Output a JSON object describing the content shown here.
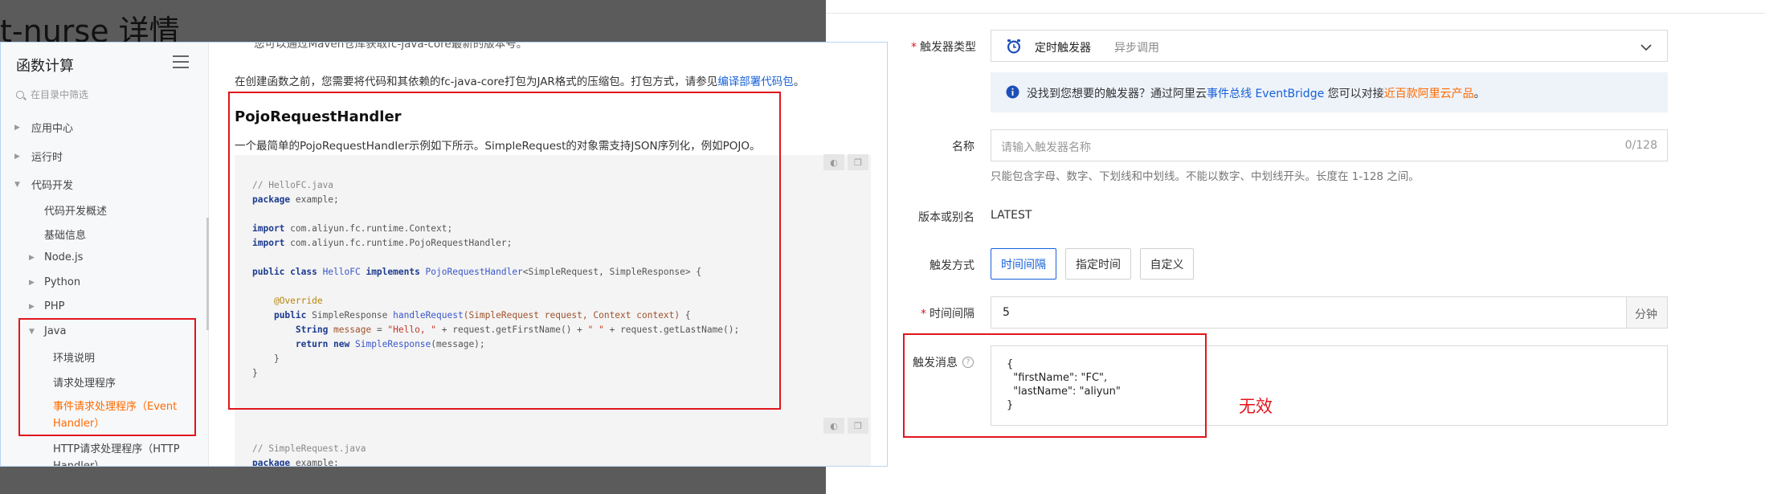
{
  "background": {
    "page_title": "t-nurse 详情"
  },
  "docs": {
    "sidebar": {
      "title": "函数计算",
      "filter_placeholder": "在目录中筛选",
      "items": [
        {
          "label": "应用中心"
        },
        {
          "label": "运行时"
        },
        {
          "label": "代码开发"
        },
        {
          "label": "代码开发概述"
        },
        {
          "label": "基础信息"
        },
        {
          "label": "Node.js"
        },
        {
          "label": "Python"
        },
        {
          "label": "PHP"
        },
        {
          "label": "Java"
        },
        {
          "label": "环境说明"
        },
        {
          "label": "请求处理程序"
        },
        {
          "label": "事件请求处理程序（Event"
        },
        {
          "label": "Handler）"
        },
        {
          "label": "HTTP请求处理程序（HTTP"
        },
        {
          "label": "Handler）"
        }
      ]
    },
    "content": {
      "top_partial": "您可以通过Maven仓库获取fc-java-core最新的版本号。",
      "intro_prefix": "在创建函数之前，您需要将代码和其依赖的fc-java-core打包为JAR格式的压缩包。打包方式，请参见",
      "intro_link": "编译部署代码包",
      "intro_suffix": "。",
      "heading": "PojoRequestHandler",
      "desc": "一个最简单的PojoRequestHandler示例如下所示。SimpleRequest的对象需支持JSON序列化，例如POJO。",
      "code1": {
        "comment": "// HelloFC.java",
        "package_kw": "package",
        "package_name": " example;",
        "import_kw": "import",
        "import1": " com.aliyun.fc.runtime.Context;",
        "import2": " com.aliyun.fc.runtime.PojoRequestHandler;",
        "class_decl_kw": "public class",
        "class_name": " HelloFC ",
        "implements_kw": "implements",
        "iface": " PojoRequestHandler",
        "generics": "<SimpleRequest, SimpleResponse> {",
        "annotation": "@Override",
        "method_kw": "public",
        "method_type": " SimpleResponse ",
        "method_name": "handleRequest",
        "method_params": "(SimpleRequest request, Context context)",
        "method_open": " {",
        "string_type": "String",
        "var_name": " message",
        "assign": " = ",
        "str1": "\"Hello, \"",
        "concat1": " + request.getFirstName() + ",
        "str2": "\" \"",
        "concat2": " + request.getLastName();",
        "return_kw": "return new",
        "return_type": " SimpleResponse",
        "return_rest": "(message);",
        "close1": "}",
        "close2": "}"
      },
      "code2": {
        "comment": "// SimpleRequest.java",
        "package_kw": "package",
        "package_name": " example;"
      }
    }
  },
  "form": {
    "trigger_type_label": "触发器类型",
    "trigger_type_value": "定时触发器",
    "trigger_type_sub": "异步调用",
    "info_prefix": "没找到您想要的触发器？通过阿里云",
    "info_link1": "事件总线 EventBridge",
    "info_mid": " 您可以对接",
    "info_link2": "近百款阿里云产品",
    "info_suffix": "。",
    "name_label": "名称",
    "name_placeholder": "请输入触发器名称",
    "name_counter": "0/128",
    "name_hint": "只能包含字母、数字、下划线和中划线。不能以数字、中划线开头。长度在 1-128 之间。",
    "version_label": "版本或别名",
    "version_value": "LATEST",
    "mode_label": "触发方式",
    "mode_options": [
      "时间间隔",
      "指定时间",
      "自定义"
    ],
    "interval_label": "时间间隔",
    "interval_value": "5",
    "interval_unit": "分钟",
    "message_label": "触发消息",
    "message_lines": [
      "{",
      "  \"firstName\": \"FC\",",
      "  \"lastName\": \"aliyun\"",
      "}"
    ],
    "annotation": "无效"
  },
  "colors": {
    "accent": "#1660d8",
    "orange": "#ff6a00",
    "annotation_red": "#e0161c",
    "backdrop": "#5b5b5b"
  }
}
